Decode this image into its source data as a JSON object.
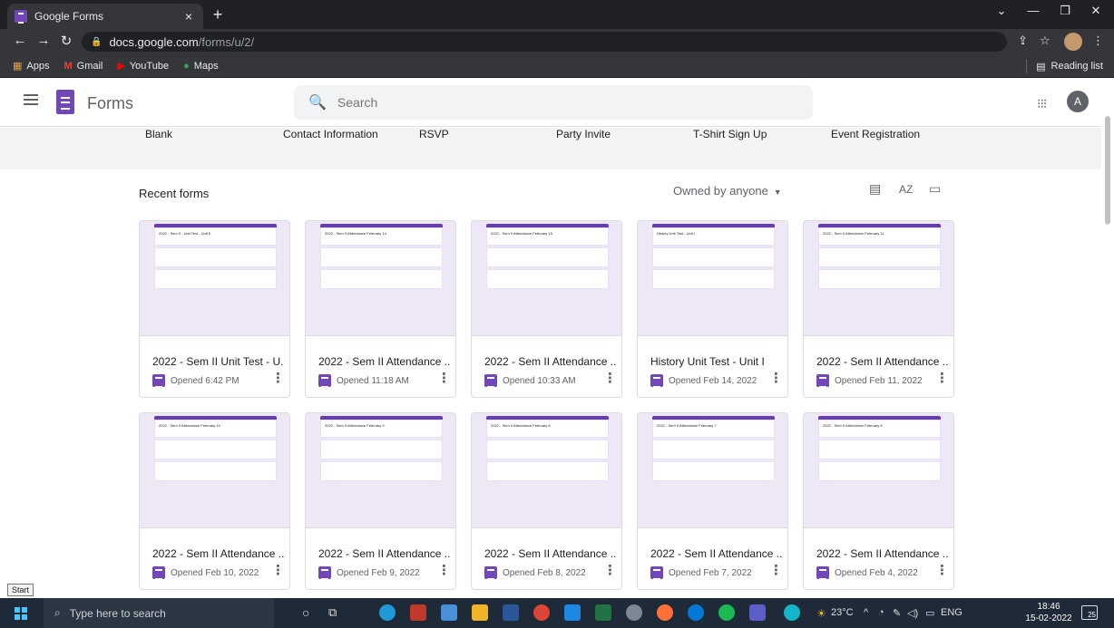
{
  "browser": {
    "tab_title": "Google Forms",
    "tab_close": "×",
    "new_tab": "+",
    "url_host": "docs.google.com",
    "url_path": "/forms/u/2/",
    "bookmarks": [
      {
        "label": "Apps",
        "icon": "apps-grid-icon"
      },
      {
        "label": "Gmail",
        "icon": "gmail-icon"
      },
      {
        "label": "YouTube",
        "icon": "youtube-icon"
      },
      {
        "label": "Maps",
        "icon": "maps-icon"
      }
    ],
    "reading_list": "Reading list"
  },
  "header": {
    "app_title": "Forms",
    "search_placeholder": "Search",
    "avatar_initial": "A"
  },
  "templates": [
    "Blank",
    "Contact Information",
    "RSVP",
    "Party Invite",
    "T-Shirt Sign Up",
    "Event Registration"
  ],
  "recent": {
    "title": "Recent forms",
    "owner_filter": "Owned by anyone",
    "forms": [
      {
        "title": "2022 - Sem II Unit Test - U...",
        "opened": "Opened 6:42 PM",
        "thumb_title": "2022 - Sem II - Unit Test - Unit II"
      },
      {
        "title": "2022 - Sem II Attendance ...",
        "opened": "Opened 11:18 AM",
        "thumb_title": "2022 - Sem II Attendance February 14"
      },
      {
        "title": "2022 - Sem II Attendance ...",
        "opened": "Opened 10:33 AM",
        "thumb_title": "2022 - Sem II Attendance February 15"
      },
      {
        "title": "History Unit Test - Unit I",
        "opened": "Opened Feb 14, 2022",
        "thumb_title": "History Unit Test - Unit I"
      },
      {
        "title": "2022 - Sem II Attendance ...",
        "opened": "Opened Feb 11, 2022",
        "thumb_title": "2022 - Sem II Attendance February 11"
      },
      {
        "title": "2022 - Sem II Attendance ...",
        "opened": "Opened Feb 10, 2022",
        "thumb_title": "2022 - Sem II Attendance February 10"
      },
      {
        "title": "2022 - Sem II Attendance ...",
        "opened": "Opened Feb 9, 2022",
        "thumb_title": "2022 - Sem II Attendance February 9"
      },
      {
        "title": "2022 - Sem II Attendance ...",
        "opened": "Opened Feb 8, 2022",
        "thumb_title": "2022 - Sem II Attendance February 8"
      },
      {
        "title": "2022 - Sem II Attendance ...",
        "opened": "Opened Feb 7, 2022",
        "thumb_title": "2022 - Sem II Attendance February 7"
      },
      {
        "title": "2022 - Sem II Attendance ...",
        "opened": "Opened Feb 4, 2022",
        "thumb_title": "2022 - Sem II Attendance February 4"
      }
    ]
  },
  "taskbar": {
    "start_tooltip": "Start",
    "search_placeholder": "Type here to search",
    "weather": "23°C",
    "language": "ENG",
    "time": "18:46",
    "date": "15-02-2022",
    "notifications": "25"
  },
  "colors": {
    "forms_purple": "#7248b9",
    "thumb_bg": "#ede7f6",
    "chrome_dark": "#202124",
    "taskbar": "#1f2a38"
  }
}
